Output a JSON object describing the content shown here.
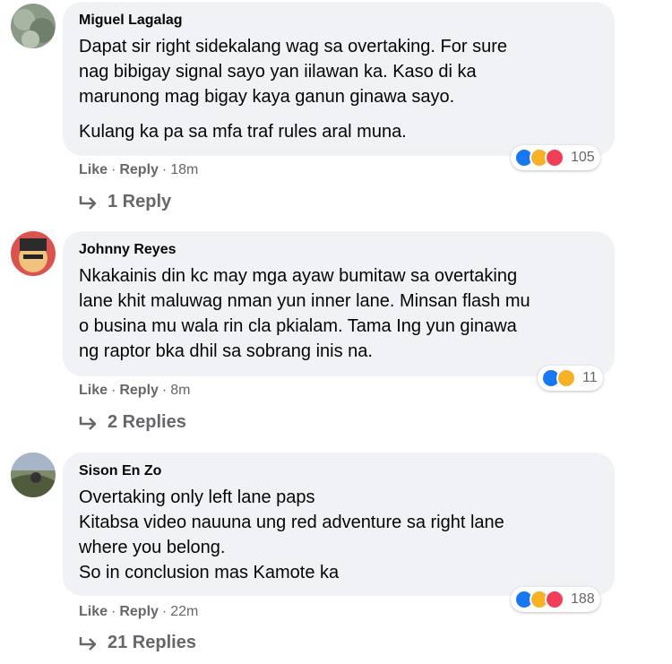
{
  "comments": [
    {
      "author": "Miguel Lagalag",
      "lines": [
        "Dapat sir right sidekalang wag sa overtaking. For sure",
        "nag bibigay signal sayo yan iilawan ka. Kaso di ka",
        "marunong mag bigay kaya ganun ginawa sayo.",
        "Kulang ka pa sa mfa traf rules aral muna."
      ],
      "reactions": [
        "like-icon",
        "haha-icon",
        "love-icon"
      ],
      "reaction_count": "105",
      "like_label": "Like",
      "reply_label": "Reply",
      "time": "18m",
      "replies_label": "1 Reply"
    },
    {
      "author": "Johnny Reyes",
      "lines": [
        "Nkakainis din kc may mga ayaw bumitaw sa overtaking",
        "lane khit maluwag nman yun inner lane. Minsan flash mu",
        "o businа mu wala rin cla pkialam. Tama Ing yun ginawa",
        "ng raptor bka dhil sa sobrang inis na."
      ],
      "reactions": [
        "like-icon",
        "haha-icon"
      ],
      "reaction_count": "11",
      "like_label": "Like",
      "reply_label": "Reply",
      "time": "8m",
      "replies_label": "2 Replies"
    },
    {
      "author": "Sison En Zo",
      "lines": [
        "Overtaking only left lane paps",
        "Kitabsa video nauuna ung red adventure sa right lane",
        "where you belong.",
        "So in conclusion mas Kamote ka"
      ],
      "reactions": [
        "like-icon",
        "haha-icon",
        "love-icon"
      ],
      "reaction_count": "188",
      "like_label": "Like",
      "reply_label": "Reply",
      "time": "22m",
      "replies_label": "21 Replies"
    }
  ],
  "colors": {
    "bubble": "#f0f2f5",
    "secondary_text": "#65676b",
    "like": "#1877f2",
    "haha": "#f7b125",
    "love": "#f33e58"
  }
}
